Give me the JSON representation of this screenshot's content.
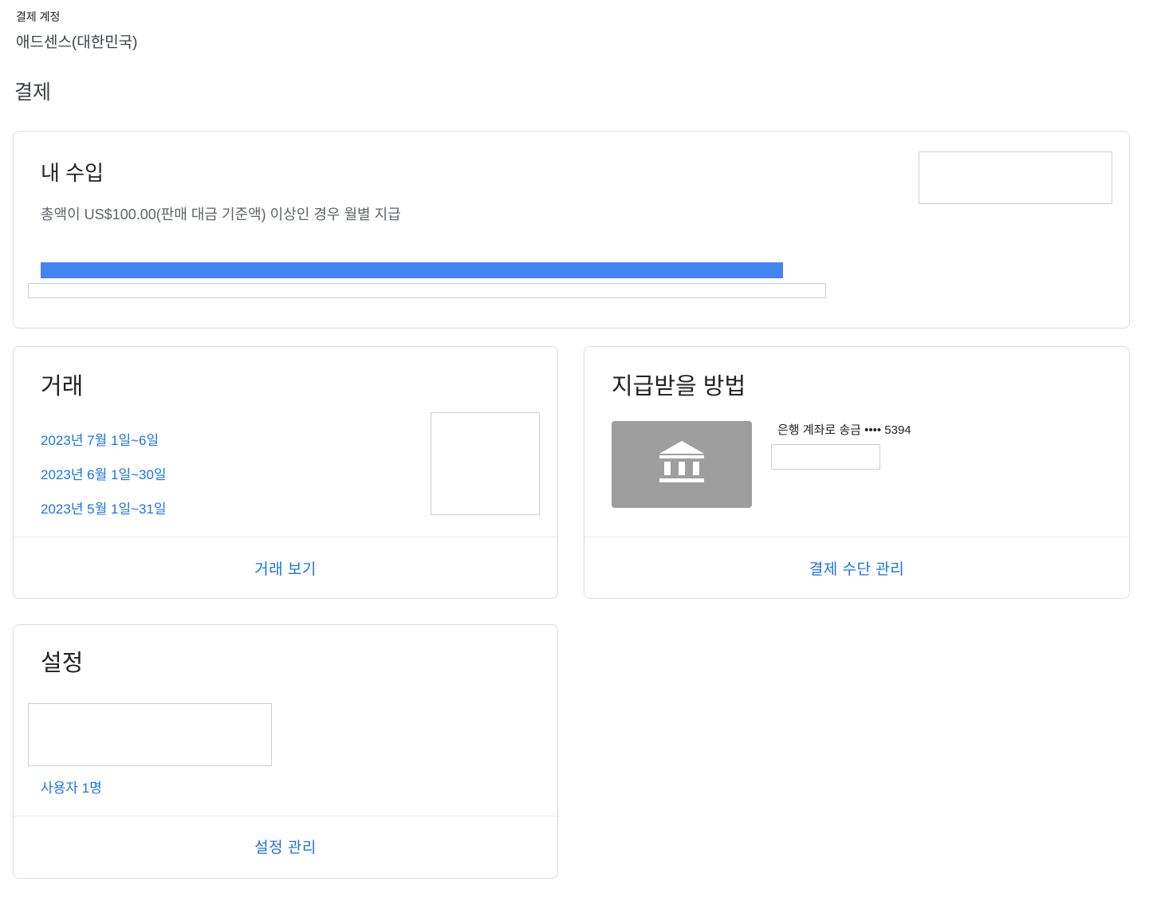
{
  "header": {
    "account_label": "결제 계정",
    "account_name": "애드센스(대한민국)",
    "page_title": "결제"
  },
  "earnings": {
    "title": "내 수입",
    "description": "총액이 US$100.00(판매 대금 기준액) 이상인 경우 월별 지급",
    "progress_fraction": 0.93,
    "progress_color": "#4285f4"
  },
  "transactions": {
    "title": "거래",
    "periods": [
      "2023년 7월 1일~6일",
      "2023년 6월 1일~30일",
      "2023년 5월 1일~31일"
    ],
    "footer_label": "거래 보기"
  },
  "payment_method": {
    "title": "지급받을 방법",
    "bank_icon": "bank-icon",
    "bank_transfer_text": "은행 계좌로 송금 •••• 5394",
    "footer_label": "결제 수단 관리"
  },
  "settings": {
    "title": "설정",
    "users_link": "사용자 1명",
    "footer_label": "설정 관리"
  },
  "colors": {
    "accent": "#1a73e8",
    "progress": "#4285f4",
    "bank_tile": "#9e9e9e",
    "border": "#dadce0"
  }
}
